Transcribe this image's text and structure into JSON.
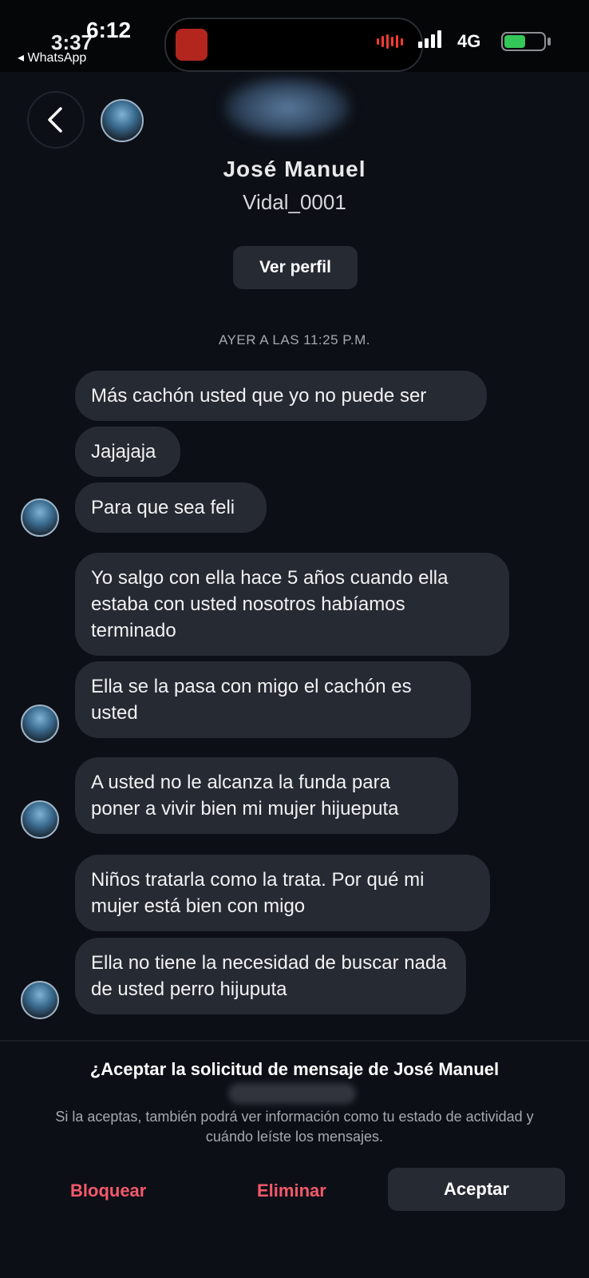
{
  "status_bar": {
    "time": "6:12",
    "time_overlay": "3:37",
    "back_app": "◂ WhatsApp",
    "network": "4G",
    "battery_level": 0.55,
    "colors": {
      "battery": "#34c759",
      "recording": "#ff3b30"
    }
  },
  "header": {
    "back_icon": "chevron-left-icon",
    "contact_name": "José Manuel",
    "username": "Vidal_0001",
    "view_profile_label": "Ver perfil"
  },
  "chat": {
    "timestamp": "AYER A LAS 11:25 P.M.",
    "messages": [
      {
        "text": "Más cachón usted que yo no puede ser"
      },
      {
        "text": "Jajajaja"
      },
      {
        "text": "Para que sea feli"
      },
      {
        "text": "Yo salgo con ella hace 5 años cuando ella estaba con usted nosotros habíamos terminado"
      },
      {
        "text": "Ella se la pasa con migo el cachón es usted"
      },
      {
        "text": "A usted no le alcanza la funda para poner a vivir bien mi mujer hijueputa"
      },
      {
        "text": "Niños tratarla como la trata. Por qué mi mujer está bien con migo"
      },
      {
        "text": "Ella no tiene la necesidad  de buscar nada de usted perro hijuputa"
      }
    ]
  },
  "request": {
    "title": "¿Aceptar la solicitud de mensaje de José Manuel",
    "description": "Si la aceptas, también podrá ver información como tu estado de actividad y cuándo leíste los mensajes.",
    "block_label": "Bloquear",
    "delete_label": "Eliminar",
    "accept_label": "Aceptar",
    "accent_color": "#f4596b"
  }
}
